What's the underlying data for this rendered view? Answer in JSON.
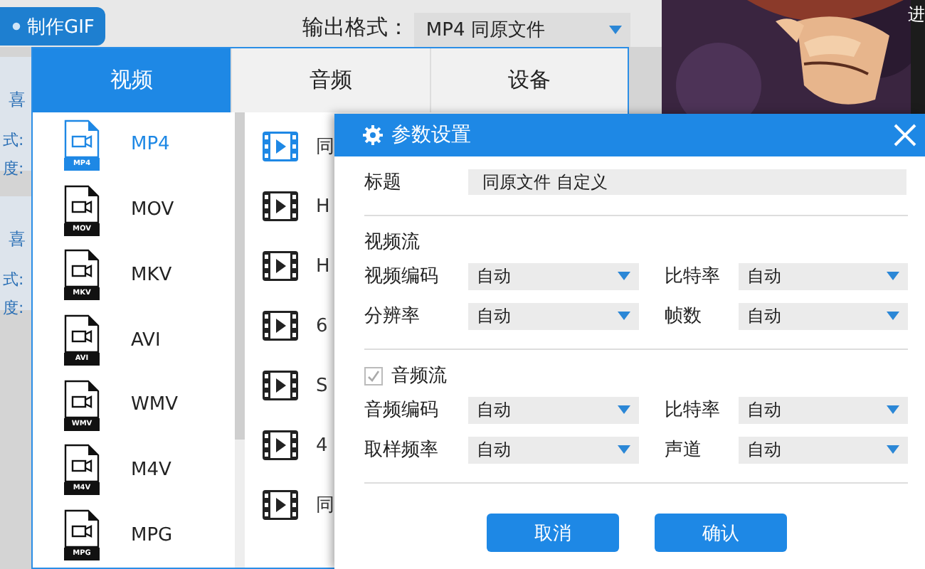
{
  "toolbar": {
    "gif_button": "制作GIF",
    "output_format_label": "输出格式：",
    "output_format_value": "MP4  同原文件"
  },
  "corner_fragment": "进",
  "left_strip": [
    {
      "title": "喜",
      "lines": [
        "式:",
        "度:"
      ]
    },
    {
      "title": "喜",
      "lines": [
        "式:",
        "度:"
      ]
    }
  ],
  "format_window": {
    "tabs": [
      {
        "label": "视频",
        "selected": true
      },
      {
        "label": "音频",
        "selected": false
      },
      {
        "label": "设备",
        "selected": false
      }
    ],
    "formats": [
      {
        "label": "MP4",
        "badge": "MP4",
        "selected": true
      },
      {
        "label": "MOV",
        "badge": "MOV",
        "selected": false
      },
      {
        "label": "MKV",
        "badge": "MKV",
        "selected": false
      },
      {
        "label": "AVI",
        "badge": "AVI",
        "selected": false
      },
      {
        "label": "WMV",
        "badge": "WMV",
        "selected": false
      },
      {
        "label": "M4V",
        "badge": "M4V",
        "selected": false
      },
      {
        "label": "MPG",
        "badge": "MPG",
        "selected": false
      }
    ],
    "presets": [
      {
        "label": "同",
        "selected": true
      },
      {
        "label": "H",
        "selected": false
      },
      {
        "label": "H",
        "selected": false
      },
      {
        "label": "6",
        "selected": false
      },
      {
        "label": "S",
        "selected": false
      },
      {
        "label": "4",
        "selected": false
      },
      {
        "label": "同",
        "selected": false
      }
    ]
  },
  "dialog": {
    "title": "参数设置",
    "title_field": {
      "label": "标题",
      "value": "同原文件 自定义"
    },
    "sections": [
      {
        "kind": "plain",
        "heading": "视频流",
        "rows": [
          [
            {
              "label": "视频编码",
              "value": "自动"
            },
            {
              "label": "比特率",
              "value": "自动"
            }
          ],
          [
            {
              "label": "分辨率",
              "value": "自动"
            },
            {
              "label": "帧数",
              "value": "自动"
            }
          ]
        ]
      },
      {
        "kind": "checkbox",
        "heading": "音频流",
        "checked": true,
        "disabled": true,
        "rows": [
          [
            {
              "label": "音频编码",
              "value": "自动"
            },
            {
              "label": "比特率",
              "value": "自动"
            }
          ],
          [
            {
              "label": "取样频率",
              "value": "自动"
            },
            {
              "label": "声道",
              "value": "自动"
            }
          ]
        ]
      }
    ],
    "buttons": [
      "取消",
      "确认"
    ]
  }
}
